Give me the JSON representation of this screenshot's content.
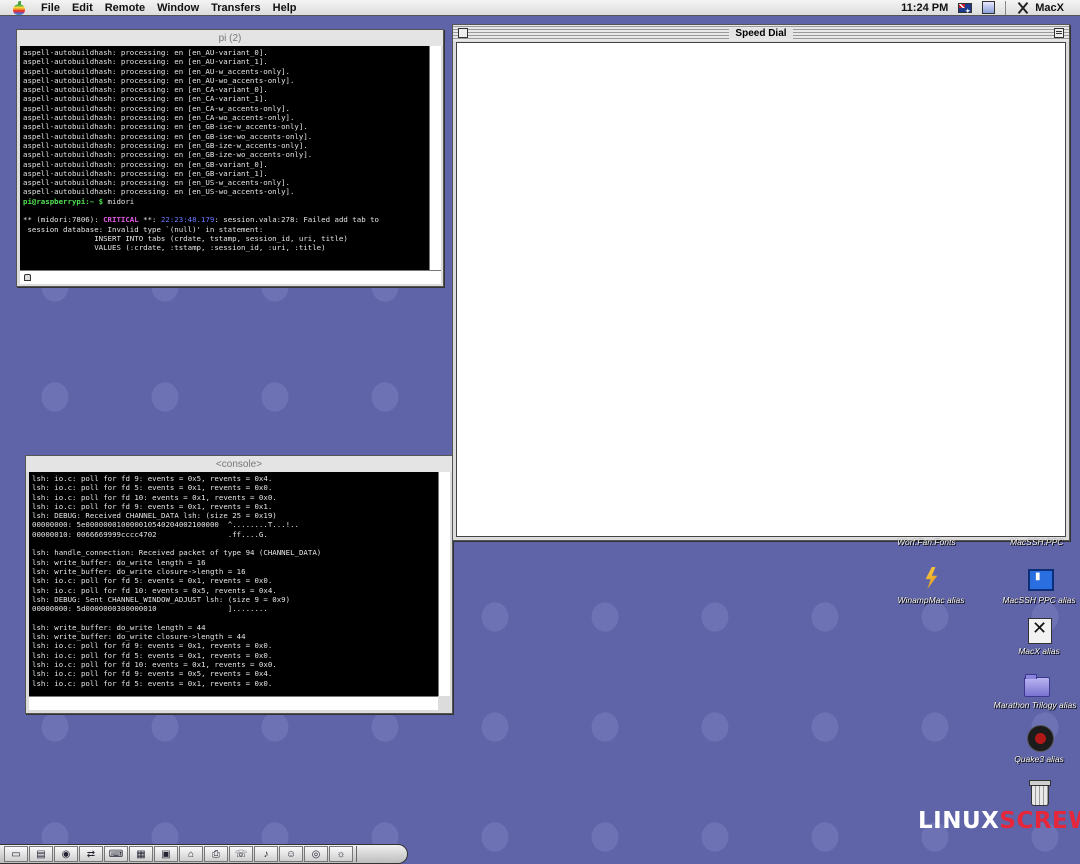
{
  "menubar": {
    "items": [
      "File",
      "Edit",
      "Remote",
      "Window",
      "Transfers",
      "Help"
    ],
    "clock": "11:24 PM",
    "app_name": "MacX"
  },
  "windows": {
    "pi": {
      "title": "pi (2)",
      "lines": [
        "aspell-autobuildhash: processing: en [en_AU-variant_0].",
        "aspell-autobuildhash: processing: en [en_AU-variant_1].",
        "aspell-autobuildhash: processing: en [en_AU-w_accents-only].",
        "aspell-autobuildhash: processing: en [en_AU-wo_accents-only].",
        "aspell-autobuildhash: processing: en [en_CA-variant_0].",
        "aspell-autobuildhash: processing: en [en_CA-variant_1].",
        "aspell-autobuildhash: processing: en [en_CA-w_accents-only].",
        "aspell-autobuildhash: processing: en [en_CA-wo_accents-only].",
        "aspell-autobuildhash: processing: en [en_GB-ise-w_accents-only].",
        "aspell-autobuildhash: processing: en [en_GB-ise-wo_accents-only].",
        "aspell-autobuildhash: processing: en [en_GB-ize-w_accents-only].",
        "aspell-autobuildhash: processing: en [en_GB-ize-wo_accents-only].",
        "aspell-autobuildhash: processing: en [en_GB-variant_0].",
        "aspell-autobuildhash: processing: en [en_GB-variant_1].",
        "aspell-autobuildhash: processing: en [en_US-w_accents-only].",
        "aspell-autobuildhash: processing: en [en_US-wo_accents-only]."
      ],
      "prompt_user": "pi@raspberrypi:~ $",
      "prompt_command": " midori",
      "error_prefix": "** (midori:7806): ",
      "error_level": "CRITICAL",
      "error_stars": " **: ",
      "error_time": "22:23:48.179",
      "error_rest": ": session.vala:278: Failed add tab to",
      "error_lines": [
        " session database: Invalid type `(null)' in statement:",
        "                INSERT INTO tabs (crdate, tstamp, session_id, uri, title)",
        "                VALUES (:crdate, :tstamp, :session_id, :uri, :title)"
      ]
    },
    "console": {
      "title": "<console>",
      "lines": [
        "lsh: io.c: poll for fd 9: events = 0x5, revents = 0x4.",
        "lsh: io.c: poll for fd 5: events = 0x1, revents = 0x0.",
        "lsh: io.c: poll for fd 10: events = 0x1, revents = 0x0.",
        "lsh: io.c: poll for fd 9: events = 0x1, revents = 0x1.",
        "lsh: DEBUG: Received CHANNEL_DATA lsh: (size 25 = 0x19)",
        "00000000: 5e000000010000010540204002100000  ^........T...!..",
        "00000010: 0066669999cccc4702                .ff....G.",
        "",
        "lsh: handle_connection: Received packet of type 94 (CHANNEL_DATA)",
        "lsh: write_buffer: do_write length = 16",
        "lsh: write_buffer: do_write closure->length = 16",
        "lsh: io.c: poll for fd 5: events = 0x1, revents = 0x0.",
        "lsh: io.c: poll for fd 10: events = 0x5, revents = 0x4.",
        "lsh: DEBUG: Sent CHANNEL_WINDOW_ADJUST lsh: (size 9 = 0x9)",
        "00000000: 5d0000000300000010                ]........",
        "",
        "lsh: write_buffer: do_write length = 44",
        "lsh: write_buffer: do_write closure->length = 44",
        "lsh: io.c: poll for fd 9: events = 0x1, revents = 0x0.",
        "lsh: io.c: poll for fd 5: events = 0x1, revents = 0x0.",
        "lsh: io.c: poll for fd 10: events = 0x1, revents = 0x0.",
        "lsh: io.c: poll for fd 9: events = 0x5, revents = 0x4.",
        "lsh: io.c: poll for fd 5: events = 0x1, revents = 0x0."
      ]
    },
    "speed_dial": {
      "title": "Speed Dial"
    }
  },
  "desktop_icons": {
    "partial_top_left": "Worf.Fan.Fonts",
    "partial_top_right": "MacSSH.PPC",
    "winamp": "WinampMac alias",
    "macssh": "MacSSH PPC alias",
    "macx": "MacX alias",
    "marathon": "Marathon Trilogy alias",
    "quake": "Quake3 alias",
    "trash": "Trash"
  },
  "watermark": {
    "part1": "LINUX",
    "part2": "SCREW"
  },
  "colors": {
    "desktop": "#5f64a8",
    "terminal_bg": "#000000",
    "prompt_green": "#52e052",
    "critical_magenta": "#e058e0",
    "watermark_red": "#e6263a"
  }
}
